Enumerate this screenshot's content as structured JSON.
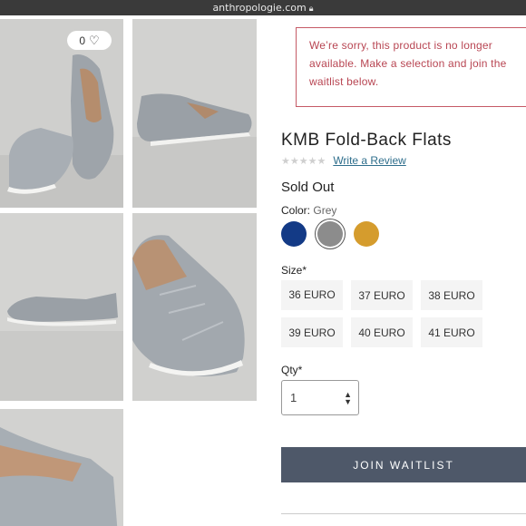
{
  "browser": {
    "url": "anthropologie.com"
  },
  "gallery": {
    "favorite_count": "0",
    "images": [
      "shoe-pair-angle",
      "shoe-side-profile",
      "shoe-side-low",
      "shoe-top-closeup",
      "shoe-heel-closeup"
    ]
  },
  "alert": {
    "line1": "We’re sorry, this product is no longer",
    "line2": "available. Make a selection and join the",
    "line3": "waitlist below."
  },
  "product": {
    "title": "KMB Fold-Back Flats",
    "review_link": "Write a Review",
    "rating": 0,
    "stock_status": "Sold Out"
  },
  "color": {
    "label": "Color:",
    "selected": "Grey",
    "swatches": [
      {
        "name": "navy",
        "hex": "#133a86"
      },
      {
        "name": "grey",
        "hex": "#8c8c8c"
      },
      {
        "name": "mustard",
        "hex": "#d59c2d"
      }
    ]
  },
  "size": {
    "label": "Size*",
    "options": [
      "36 EURO",
      "37 EURO",
      "38 EURO",
      "39 EURO",
      "40 EURO",
      "41 EURO"
    ]
  },
  "quantity": {
    "label": "Qty*",
    "value": "1"
  },
  "cta": {
    "label": "JOIN WAITLIST"
  }
}
